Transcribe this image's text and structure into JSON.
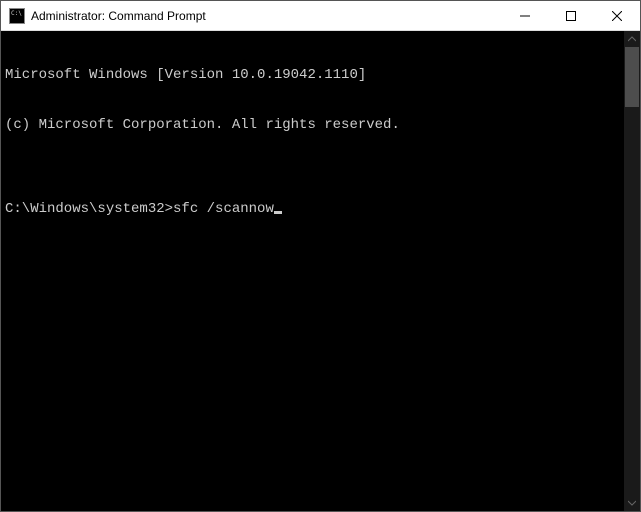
{
  "titlebar": {
    "title": "Administrator: Command Prompt"
  },
  "terminal": {
    "line1": "Microsoft Windows [Version 10.0.19042.1110]",
    "line2": "(c) Microsoft Corporation. All rights reserved.",
    "blank": "",
    "prompt": "C:\\Windows\\system32>",
    "command": "sfc /scannow"
  }
}
